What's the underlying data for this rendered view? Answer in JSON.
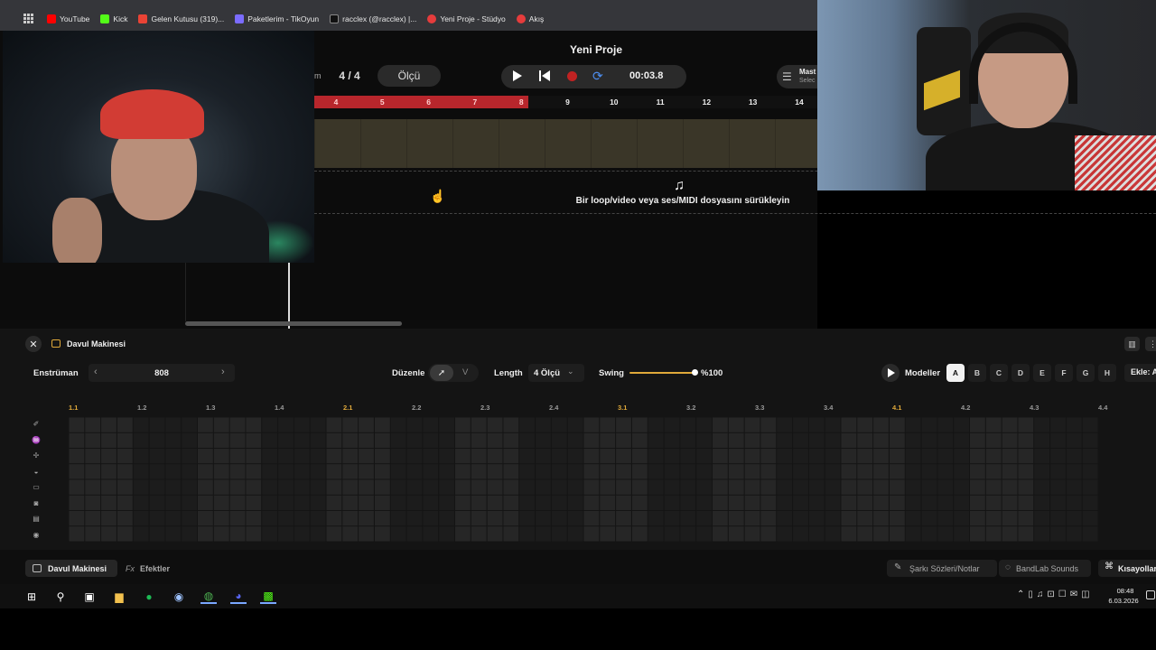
{
  "bookmarks": [
    {
      "label": "YouTube",
      "color": "#ff0000"
    },
    {
      "label": "Kick",
      "color": "#53fc18"
    },
    {
      "label": "Gelen Kutusu (319)...",
      "color": "#ea4335"
    },
    {
      "label": "Paketlerim - TikOyun",
      "color": "#7b6cff"
    },
    {
      "label": "racclex (@racclex) |...",
      "color": "#111111"
    },
    {
      "label": "Yeni Proje - Stüdyo",
      "color": "#e63c3c"
    },
    {
      "label": "Akış",
      "color": "#e63c3c"
    }
  ],
  "daw": {
    "project_title": "Yeni Proje",
    "time_signature": "4 / 4",
    "bar_button": "Ölçü",
    "partial_label": "m",
    "time": "00:03.8",
    "mastering_label": "Mast",
    "mastering_sub": "Selec",
    "ruler_ticks": [
      "4",
      "5",
      "6",
      "7",
      "8",
      "9",
      "10",
      "11",
      "12",
      "13",
      "14"
    ],
    "drop_text": "Bir loop/video veya ses/MIDI dosyasını sürükleyin"
  },
  "drum_machine": {
    "title": "Davul Makinesi",
    "instrument_label": "Enstrüman",
    "instrument_value": "808",
    "edit_label": "Düzenle",
    "edit_v": "V",
    "length_label": "Length",
    "length_value": "4 Ölçü",
    "swing_label": "Swing",
    "swing_value": "%100",
    "swing_level": 1.0,
    "models_label": "Modeller",
    "patterns": [
      "A",
      "B",
      "C",
      "D",
      "E",
      "F",
      "G",
      "H"
    ],
    "active_pattern": "A",
    "add_button": "Ekle: A",
    "beats": [
      "1.1",
      "1.2",
      "1.3",
      "1.4",
      "2.1",
      "2.2",
      "2.3",
      "2.4",
      "3.1",
      "3.2",
      "3.3",
      "3.4",
      "4.1",
      "4.2",
      "4.3",
      "4.4"
    ],
    "row_icons": [
      "✐",
      "♒",
      "✢",
      "◒",
      "▭",
      "◙",
      "▤",
      "◉"
    ]
  },
  "bottom_bar": {
    "tab_drum": "Davul Makinesi",
    "tab_fx_icon": "Fx",
    "tab_fx": "Efektler",
    "lyrics": "Şarkı Sözleri/Notlar",
    "sounds": "BandLab Sounds",
    "shortcuts": "Kısayollar"
  },
  "taskbar": {
    "time": "08:48",
    "date": "6.03.2026"
  },
  "colors": {
    "accent": "#e0a93a",
    "record": "#c02222",
    "loop": "#4d8ef0",
    "ruler_red": "#b8262c"
  }
}
